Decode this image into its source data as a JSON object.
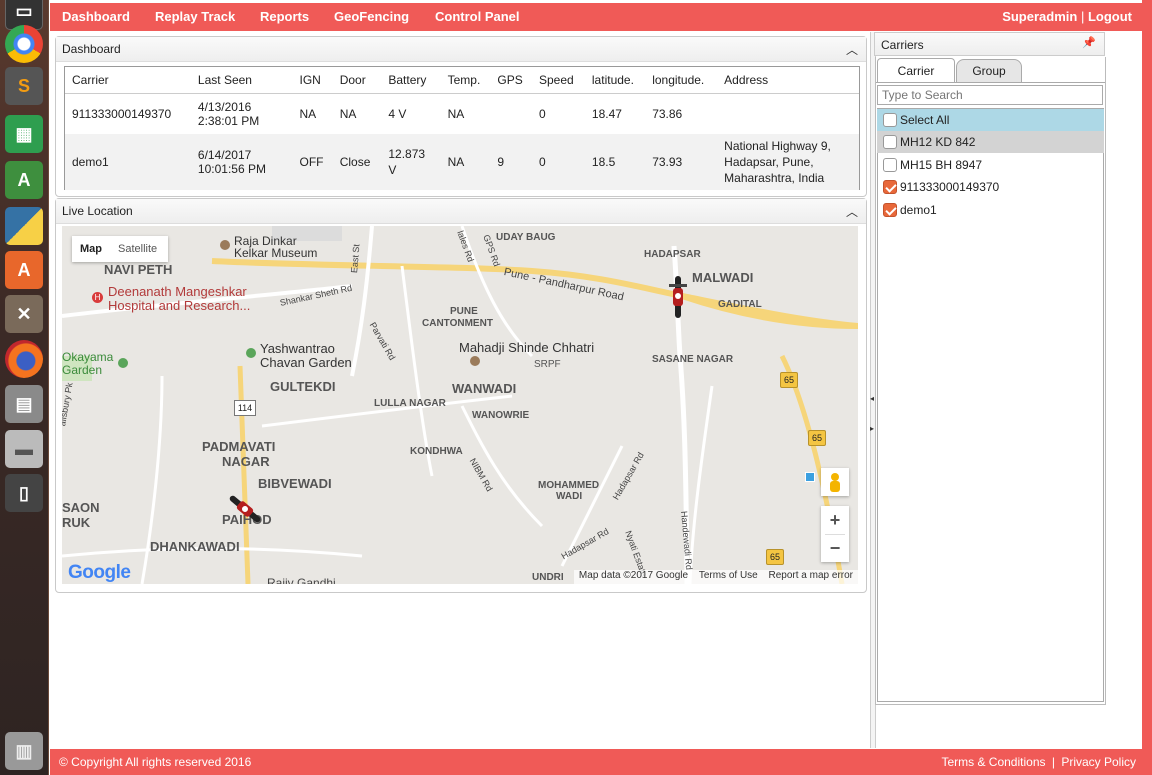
{
  "nav": {
    "items": [
      "Dashboard",
      "Replay Track",
      "Reports",
      "GeoFencing",
      "Control Panel"
    ],
    "user": "Superadmin",
    "separator": "|",
    "logout": "Logout"
  },
  "dashboard": {
    "title": "Dashboard",
    "columns": [
      "Carrier",
      "Last Seen",
      "IGN",
      "Door",
      "Battery",
      "Temp.",
      "GPS",
      "Speed",
      "latitude.",
      "longitude.",
      "Address"
    ],
    "rows": [
      {
        "carrier": "911333000149370",
        "last_seen_date": "4/13/2016",
        "last_seen_time": "2:38:01 PM",
        "ign": "NA",
        "door": "NA",
        "battery": "4 V",
        "temp": "NA",
        "gps": "",
        "speed": "0",
        "latitude": "18.47",
        "longitude": "73.86",
        "address": ""
      },
      {
        "carrier": "demo1",
        "last_seen_date": "6/14/2017",
        "last_seen_time": "10:01:56 PM",
        "ign": "OFF",
        "door": "Close",
        "battery": "12.873 V",
        "temp": "NA",
        "gps": "9",
        "speed": "0",
        "latitude": "18.5",
        "longitude": "73.93",
        "address": "National Highway 9, Hadapsar, Pune, Maharashtra, India"
      }
    ]
  },
  "live_location": {
    "title": "Live Location",
    "map_type_map": "Map",
    "map_type_satellite": "Satellite",
    "google": "Google",
    "map_data": "Map data ©2017 Google",
    "terms": "Terms of Use",
    "report": "Report a map error",
    "zoom_in": "+",
    "zoom_out": "−",
    "places": {
      "raja_dinkar_1": "Raja Dinkar",
      "raja_dinkar_2": "Kelkar Museum",
      "navi_peth": "NAVI PETH",
      "deenanath_1": "Deenanath Mangeshkar",
      "deenanath_2": "Hospital and Research...",
      "okayama_1": "Okayama",
      "okayama_2": "Garden",
      "yashwantrao_1": "Yashwantrao",
      "yashwantrao_2": "Chavan Garden",
      "gultekdi": "GULTEKDI",
      "padmavati_1": "PADMAVATI",
      "padmavati_2": "NAGAR",
      "bibvewadi": "BIBVEWADI",
      "dhankawadi": "DHANKAWADI",
      "saon_1": "SAON",
      "saon_2": "RUK",
      "pawhod": "PAIHOD",
      "rajiv_gandhi": "Rajiv Gandhi",
      "uday_baug": "UDAY BAUG",
      "pune_pandharpur": "Pune - Pandharpur Road",
      "pune_cantonment_1": "PUNE",
      "pune_cantonment_2": "CANTONMENT",
      "mahadji": "Mahadji Shinde Chhatri",
      "srpf": "SRPF",
      "wanwadi": "WANWADI",
      "lulla_nagar": "LULLA NAGAR",
      "wanowrie": "WANOWRIE",
      "kondhwa": "KONDHWA",
      "mohammed_1": "MOHAMMED",
      "mohammed_2": "WADI",
      "hadapsar": "HADAPSAR",
      "malwadi": "MALWADI",
      "gadital": "GADITAL",
      "sasane_nagar": "SASANE NAGAR",
      "shankar_sheth": "Shankar Sheth Rd",
      "east_st": "East St",
      "parvati_rd": "Parvati Rd",
      "gales_rd": "lales Rd",
      "gps_rd": "GPS Rd",
      "nibm_rd": "NIBM Rd",
      "hadapsar_rd": "Hadapsar Rd",
      "hadapsar_rd2": "Hadapsar Rd",
      "handewadi_rd": "Handewadi Rd",
      "nyati_estate": "Nyati Estate",
      "undri": "UNDRI",
      "salisbury": "alisbury Pk",
      "route_114": "114",
      "route_65a": "65",
      "route_65b": "65",
      "route_65c": "65"
    }
  },
  "carriers": {
    "title": "Carriers",
    "tabs": [
      "Carrier",
      "Group"
    ],
    "search_placeholder": "Type to Search",
    "items": [
      {
        "label": "Select All",
        "checked": false
      },
      {
        "label": "MH12 KD 842",
        "checked": false
      },
      {
        "label": "MH15 BH 8947",
        "checked": false
      },
      {
        "label": "911333000149370",
        "checked": true
      },
      {
        "label": "demo1",
        "checked": true
      }
    ]
  },
  "footer": {
    "copyright": "© Copyright All rights reserved 2016",
    "terms": "Terms & Conditions",
    "separator": "|",
    "privacy": "Privacy Policy"
  },
  "colors": {
    "brand": "#f05a57",
    "checkbox_checked": "#e8683a",
    "selected_row": "#add8e6"
  }
}
